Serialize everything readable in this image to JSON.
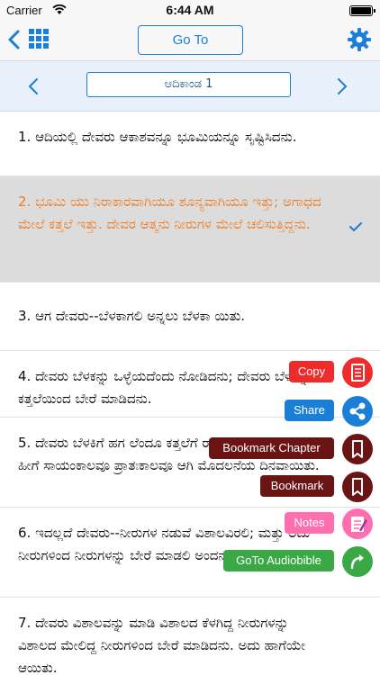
{
  "status": {
    "carrier": "Carrier",
    "time": "6:44 AM"
  },
  "nav": {
    "goto_label": "Go To"
  },
  "chapter": {
    "title": "ಆದಿಕಾಂಡ 1"
  },
  "verses": [
    {
      "text": "1. ಆದಿಯಲ್ಲಿ ದೇವರು ಆಕಾಶವನ್ನೂ ಭೂಮಿಯನ್ನೂ ಸೃಷ್ಟಿಸಿದನು."
    },
    {
      "text": "2. ಭೂಮಿ ಯು ನಿರಾಕಾರವಾಗಿಯೂ ಶೂನ್ಯವಾಗಿಯೂ ಇತ್ತು; ಅಗಾಧದ ಮೇಲೆ ಕತ್ತಲೆ ಇತ್ತು. ದೇವರ ಆತ್ಮನು ನೀರುಗಳ ಮೇಲೆ ಚಲಿಸುತ್ತಿದ್ದನು."
    },
    {
      "text": "3. ಆಗ ದೇವರು--ಬೆಳಕಾಗಲಿ ಅನ್ನಲು ಬೆಳಕಾ ಯಿತು."
    },
    {
      "text": "4. ದೇವರು ಬೆಳಕನ್ನು ಒಳ್ಳೆಯದೆಂದು ನೋಡಿದನು; ದೇವರು ಬೆಳಕನ್ನು ಕತ್ತಲೆಯಿಂದ ಬೇರೆ ಮಾಡಿದನು."
    },
    {
      "text": "5. ದೇವರು ಬೆಳಕಿಗೆ ಹಗ ಲೆಂದೂ ಕತ್ತಲೆಗೆ ರಾತ್ರಿಯೆಂದೂ ಕರೆದನು. ಹೀಗೆ ಸಾಯಂಕಾಲವೂ ಪ್ರಾತಃಕಾಲವೂ ಆಗಿ ಮೊದಲನೆಯ ದಿನವಾಯಿತು."
    },
    {
      "text": "6. ಇದಲ್ಲದೆ ದೇವರು--ನೀರುಗಳ ನಡುವೆ ವಿಶಾಲವಿರಲಿ; ಮತ್ತು ಅದು ನೀರುಗಳಿಂದ ನೀರುಗಳನ್ನು ಬೇರೆ ಮಾಡಲಿ ಅಂದನು."
    },
    {
      "text": "7. ದೇವರು ವಿಶಾಲವನ್ನು ಮಾಡಿ ವಿಶಾಲದ ಕೆಳಗಿದ್ದ ನೀರುಗಳನ್ನು ವಿಶಾಲದ ಮೇಲಿದ್ದ ನೀರುಗಳಿಂದ ಬೇರೆ ಮಾಡಿದನು. ಅದು ಹಾಗೆಯೇ ಆಯಿತು."
    }
  ],
  "actions": {
    "copy": "Copy",
    "share": "Share",
    "bookmark_chapter": "Bookmark Chapter",
    "bookmark": "Bookmark",
    "notes": "Notes",
    "goto_audiobible": "GoTo Audiobible"
  },
  "colors": {
    "accent": "#1a7fd7",
    "selected_text": "#ef7d23",
    "copy": "#ef2b2b",
    "share": "#1a7fd7",
    "bookmark": "#6b1414",
    "notes": "#ff6fb0",
    "audiobible": "#3aa845"
  }
}
